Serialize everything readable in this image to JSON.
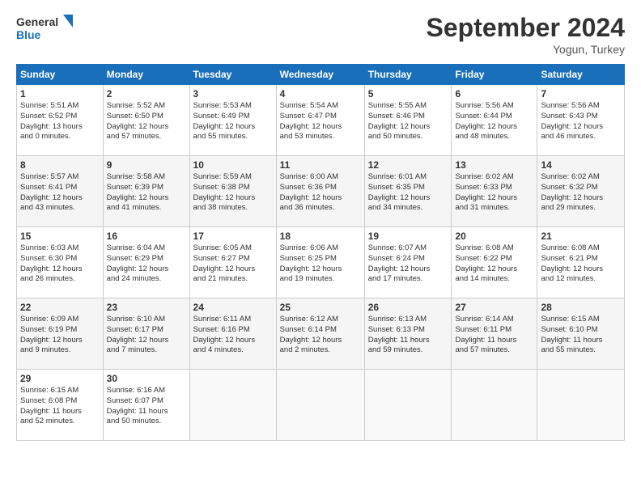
{
  "header": {
    "logo_line1": "General",
    "logo_line2": "Blue",
    "month": "September 2024",
    "location": "Yogun, Turkey"
  },
  "days_of_week": [
    "Sunday",
    "Monday",
    "Tuesday",
    "Wednesday",
    "Thursday",
    "Friday",
    "Saturday"
  ],
  "weeks": [
    [
      {
        "day": "1",
        "lines": [
          "Sunrise: 5:51 AM",
          "Sunset: 6:52 PM",
          "Daylight: 13 hours",
          "and 0 minutes."
        ]
      },
      {
        "day": "2",
        "lines": [
          "Sunrise: 5:52 AM",
          "Sunset: 6:50 PM",
          "Daylight: 12 hours",
          "and 57 minutes."
        ]
      },
      {
        "day": "3",
        "lines": [
          "Sunrise: 5:53 AM",
          "Sunset: 6:49 PM",
          "Daylight: 12 hours",
          "and 55 minutes."
        ]
      },
      {
        "day": "4",
        "lines": [
          "Sunrise: 5:54 AM",
          "Sunset: 6:47 PM",
          "Daylight: 12 hours",
          "and 53 minutes."
        ]
      },
      {
        "day": "5",
        "lines": [
          "Sunrise: 5:55 AM",
          "Sunset: 6:46 PM",
          "Daylight: 12 hours",
          "and 50 minutes."
        ]
      },
      {
        "day": "6",
        "lines": [
          "Sunrise: 5:56 AM",
          "Sunset: 6:44 PM",
          "Daylight: 12 hours",
          "and 48 minutes."
        ]
      },
      {
        "day": "7",
        "lines": [
          "Sunrise: 5:56 AM",
          "Sunset: 6:43 PM",
          "Daylight: 12 hours",
          "and 46 minutes."
        ]
      }
    ],
    [
      {
        "day": "8",
        "lines": [
          "Sunrise: 5:57 AM",
          "Sunset: 6:41 PM",
          "Daylight: 12 hours",
          "and 43 minutes."
        ]
      },
      {
        "day": "9",
        "lines": [
          "Sunrise: 5:58 AM",
          "Sunset: 6:39 PM",
          "Daylight: 12 hours",
          "and 41 minutes."
        ]
      },
      {
        "day": "10",
        "lines": [
          "Sunrise: 5:59 AM",
          "Sunset: 6:38 PM",
          "Daylight: 12 hours",
          "and 38 minutes."
        ]
      },
      {
        "day": "11",
        "lines": [
          "Sunrise: 6:00 AM",
          "Sunset: 6:36 PM",
          "Daylight: 12 hours",
          "and 36 minutes."
        ]
      },
      {
        "day": "12",
        "lines": [
          "Sunrise: 6:01 AM",
          "Sunset: 6:35 PM",
          "Daylight: 12 hours",
          "and 34 minutes."
        ]
      },
      {
        "day": "13",
        "lines": [
          "Sunrise: 6:02 AM",
          "Sunset: 6:33 PM",
          "Daylight: 12 hours",
          "and 31 minutes."
        ]
      },
      {
        "day": "14",
        "lines": [
          "Sunrise: 6:02 AM",
          "Sunset: 6:32 PM",
          "Daylight: 12 hours",
          "and 29 minutes."
        ]
      }
    ],
    [
      {
        "day": "15",
        "lines": [
          "Sunrise: 6:03 AM",
          "Sunset: 6:30 PM",
          "Daylight: 12 hours",
          "and 26 minutes."
        ]
      },
      {
        "day": "16",
        "lines": [
          "Sunrise: 6:04 AM",
          "Sunset: 6:29 PM",
          "Daylight: 12 hours",
          "and 24 minutes."
        ]
      },
      {
        "day": "17",
        "lines": [
          "Sunrise: 6:05 AM",
          "Sunset: 6:27 PM",
          "Daylight: 12 hours",
          "and 21 minutes."
        ]
      },
      {
        "day": "18",
        "lines": [
          "Sunrise: 6:06 AM",
          "Sunset: 6:25 PM",
          "Daylight: 12 hours",
          "and 19 minutes."
        ]
      },
      {
        "day": "19",
        "lines": [
          "Sunrise: 6:07 AM",
          "Sunset: 6:24 PM",
          "Daylight: 12 hours",
          "and 17 minutes."
        ]
      },
      {
        "day": "20",
        "lines": [
          "Sunrise: 6:08 AM",
          "Sunset: 6:22 PM",
          "Daylight: 12 hours",
          "and 14 minutes."
        ]
      },
      {
        "day": "21",
        "lines": [
          "Sunrise: 6:08 AM",
          "Sunset: 6:21 PM",
          "Daylight: 12 hours",
          "and 12 minutes."
        ]
      }
    ],
    [
      {
        "day": "22",
        "lines": [
          "Sunrise: 6:09 AM",
          "Sunset: 6:19 PM",
          "Daylight: 12 hours",
          "and 9 minutes."
        ]
      },
      {
        "day": "23",
        "lines": [
          "Sunrise: 6:10 AM",
          "Sunset: 6:17 PM",
          "Daylight: 12 hours",
          "and 7 minutes."
        ]
      },
      {
        "day": "24",
        "lines": [
          "Sunrise: 6:11 AM",
          "Sunset: 6:16 PM",
          "Daylight: 12 hours",
          "and 4 minutes."
        ]
      },
      {
        "day": "25",
        "lines": [
          "Sunrise: 6:12 AM",
          "Sunset: 6:14 PM",
          "Daylight: 12 hours",
          "and 2 minutes."
        ]
      },
      {
        "day": "26",
        "lines": [
          "Sunrise: 6:13 AM",
          "Sunset: 6:13 PM",
          "Daylight: 11 hours",
          "and 59 minutes."
        ]
      },
      {
        "day": "27",
        "lines": [
          "Sunrise: 6:14 AM",
          "Sunset: 6:11 PM",
          "Daylight: 11 hours",
          "and 57 minutes."
        ]
      },
      {
        "day": "28",
        "lines": [
          "Sunrise: 6:15 AM",
          "Sunset: 6:10 PM",
          "Daylight: 11 hours",
          "and 55 minutes."
        ]
      }
    ],
    [
      {
        "day": "29",
        "lines": [
          "Sunrise: 6:15 AM",
          "Sunset: 6:08 PM",
          "Daylight: 11 hours",
          "and 52 minutes."
        ]
      },
      {
        "day": "30",
        "lines": [
          "Sunrise: 6:16 AM",
          "Sunset: 6:07 PM",
          "Daylight: 11 hours",
          "and 50 minutes."
        ]
      },
      {
        "day": "",
        "lines": []
      },
      {
        "day": "",
        "lines": []
      },
      {
        "day": "",
        "lines": []
      },
      {
        "day": "",
        "lines": []
      },
      {
        "day": "",
        "lines": []
      }
    ]
  ]
}
